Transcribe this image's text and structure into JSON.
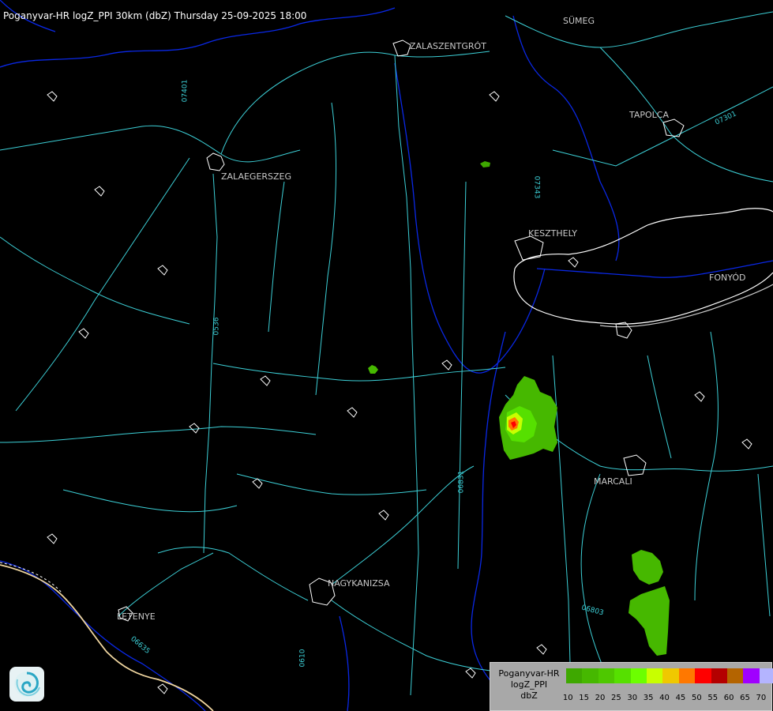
{
  "header": {
    "title": "Poganyvar-HR logZ_PPI 30km (dbZ) Thursday 25-09-2025 18:00"
  },
  "cities": [
    {
      "id": "sumeg",
      "name": "SÜMEG"
    },
    {
      "id": "zalaszentgrot",
      "name": "ZALASZENTGRÓT"
    },
    {
      "id": "tapolca",
      "name": "TAPOLCA"
    },
    {
      "id": "zalaegerszeg",
      "name": "ZALAEGERSZEG"
    },
    {
      "id": "keszthely",
      "name": "KESZTHELY"
    },
    {
      "id": "fonyod",
      "name": "FONYÓD"
    },
    {
      "id": "marcali",
      "name": "MARCALI"
    },
    {
      "id": "nagykanizsa",
      "name": "NAGYKANIZSA"
    },
    {
      "id": "letenye",
      "name": "LETENYE"
    }
  ],
  "road_labels": [
    "07401",
    "07343",
    "07301",
    "0536",
    "06831",
    "06803",
    "06635",
    "0610"
  ],
  "legend": {
    "name_lines": [
      "Poganyvar-HR",
      "logZ_PPI",
      "dbZ"
    ],
    "colors": [
      "#3ea800",
      "#46b800",
      "#4ec800",
      "#56e000",
      "#6cff00",
      "#c8ff00",
      "#f0c800",
      "#ff7800",
      "#ff0000",
      "#b40000",
      "#b46400",
      "#a000ff",
      "#b4b4ff"
    ],
    "ticks": [
      "10",
      "15",
      "20",
      "25",
      "30",
      "35",
      "40",
      "45",
      "50",
      "55",
      "60",
      "65",
      "70"
    ]
  },
  "colors": {
    "background": "#000000",
    "roads": "#3ccfd6",
    "rivers": "#0a28e6",
    "borders": "#ffffff"
  }
}
